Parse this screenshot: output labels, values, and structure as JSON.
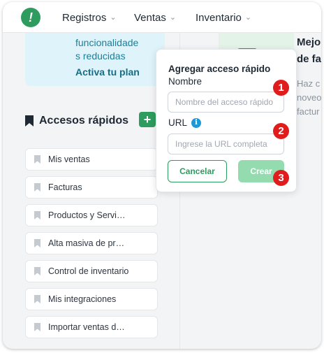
{
  "topbar": {
    "logo_glyph": "!",
    "nav": [
      {
        "label": "Registros"
      },
      {
        "label": "Ventas"
      },
      {
        "label": "Inventario"
      }
    ]
  },
  "plan_card": {
    "lines": [
      "funcionalidade",
      "s reducidas"
    ],
    "link": "Activa tu plan"
  },
  "quick_access": {
    "title": "Accesos rápidos",
    "add_glyph": "+",
    "items": [
      {
        "label": "Mis ventas"
      },
      {
        "label": "Facturas"
      },
      {
        "label": "Productos y Servi…"
      },
      {
        "label": "Alta masiva de pr…"
      },
      {
        "label": "Control de inventario"
      },
      {
        "label": "Mis integraciones"
      },
      {
        "label": "Importar ventas d…"
      }
    ]
  },
  "promo": {
    "title_lines": [
      "Mejo",
      "de fa"
    ],
    "desc_lines": [
      "Haz c",
      "noveo",
      "factur"
    ]
  },
  "popover": {
    "title": "Agregar acceso rápido",
    "name_label": "Nombre",
    "name_placeholder": "Nombre del acceso rápido",
    "url_label": "URL",
    "url_placeholder": "Ingrese la URL completa",
    "info_glyph": "i",
    "cancel_label": "Cancelar",
    "create_label": "Crear"
  },
  "markers": [
    "1",
    "2",
    "3"
  ],
  "colors": {
    "brand_green": "#2e9c5e",
    "create_disabled": "#95dbb0",
    "info_blue": "#1d9ad6",
    "marker_red": "#e01c1c",
    "plan_bg": "#dff3fb"
  }
}
